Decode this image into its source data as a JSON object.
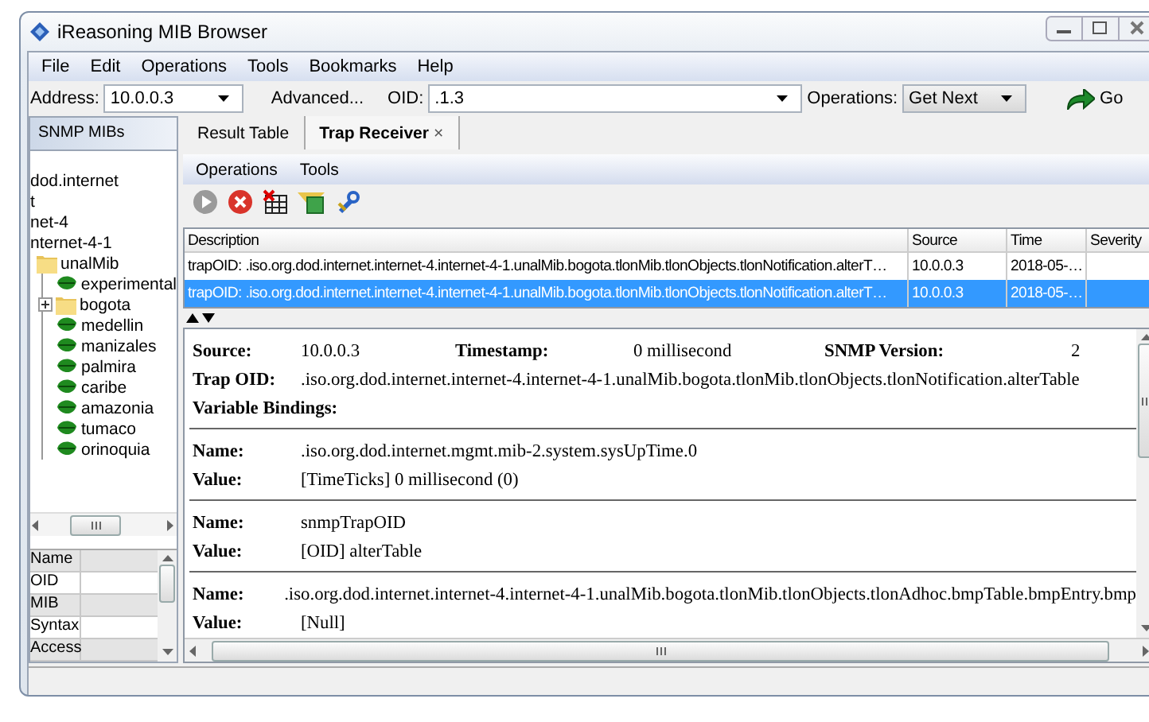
{
  "window": {
    "title": "iReasoning MIB Browser"
  },
  "menu": [
    "File",
    "Edit",
    "Operations",
    "Tools",
    "Bookmarks",
    "Help"
  ],
  "address_bar": {
    "address_label": "Address:",
    "address_value": "10.0.0.3",
    "advanced_button": "Advanced...",
    "oid_label": "OID:",
    "oid_value": ".1.3",
    "operations_label": "Operations:",
    "operations_value": "Get Next",
    "go_button": "Go"
  },
  "mib_panel": {
    "title": "SNMP MIBs",
    "tree": [
      {
        "label": "dod.internet",
        "kind": "node"
      },
      {
        "label": "t",
        "kind": "node"
      },
      {
        "label": "net-4",
        "kind": "node"
      },
      {
        "label": "nternet-4-1",
        "kind": "node"
      },
      {
        "label": "unalMib",
        "kind": "folder",
        "children": [
          {
            "label": "experimental",
            "kind": "leaf"
          },
          {
            "label": "bogota",
            "kind": "folder",
            "expanded": false
          },
          {
            "label": "medellin",
            "kind": "leaf"
          },
          {
            "label": "manizales",
            "kind": "leaf"
          },
          {
            "label": "palmira",
            "kind": "leaf"
          },
          {
            "label": "caribe",
            "kind": "leaf"
          },
          {
            "label": "amazonia",
            "kind": "leaf"
          },
          {
            "label": "tumaco",
            "kind": "leaf"
          },
          {
            "label": "orinoquia",
            "kind": "leaf"
          }
        ]
      }
    ],
    "properties": [
      "Name",
      "OID",
      "MIB",
      "Syntax",
      "Access"
    ]
  },
  "tabs": [
    {
      "label": "Result Table",
      "selected": false
    },
    {
      "label": "Trap Receiver",
      "selected": true,
      "close": "×"
    }
  ],
  "sub_menu": [
    "Operations",
    "Tools"
  ],
  "trap_table": {
    "columns": [
      "Description",
      "Source",
      "Time",
      "Severity"
    ],
    "rows": [
      {
        "cells": [
          "trapOID: .iso.org.dod.internet.internet-4.internet-4-1.unalMib.bogota.tlonMib.tlonObjects.tlonNotification.alterT…",
          "10.0.0.3",
          "2018-05-…",
          ""
        ],
        "selected": false
      },
      {
        "cells": [
          "trapOID: .iso.org.dod.internet.internet-4.internet-4-1.unalMib.bogota.tlonMib.tlonObjects.tlonNotification.alterT…",
          "10.0.0.3",
          "2018-05-…",
          ""
        ],
        "selected": true
      }
    ]
  },
  "detail": {
    "source_label": "Source:",
    "source": "10.0.0.3",
    "timestamp_label": "Timestamp:",
    "timestamp": "0 millisecond",
    "version_label": "SNMP Version:",
    "version": "2",
    "trap_oid_label": "Trap OID:",
    "trap_oid": ".iso.org.dod.internet.internet-4.internet-4-1.unalMib.bogota.tlonMib.tlonObjects.tlonNotification.alterTable",
    "bindings_label": "Variable Bindings:",
    "bindings": [
      {
        "name_label": "Name:",
        "name": ".iso.org.dod.internet.mgmt.mib-2.system.sysUpTime.0",
        "value_label": "Value:",
        "value": "[TimeTicks] 0 millisecond (0)"
      },
      {
        "name_label": "Name:",
        "name": "snmpTrapOID",
        "value_label": "Value:",
        "value": "[OID] alterTable"
      },
      {
        "name_label": "Name:",
        "name": ".iso.org.dod.internet.internet-4.internet-4-1.unalMib.bogota.tlonMib.tlonObjects.tlonAdhoc.bmpTable.bmpEntry.bmp",
        "value_label": "Value:",
        "value": "[Null]"
      }
    ]
  }
}
